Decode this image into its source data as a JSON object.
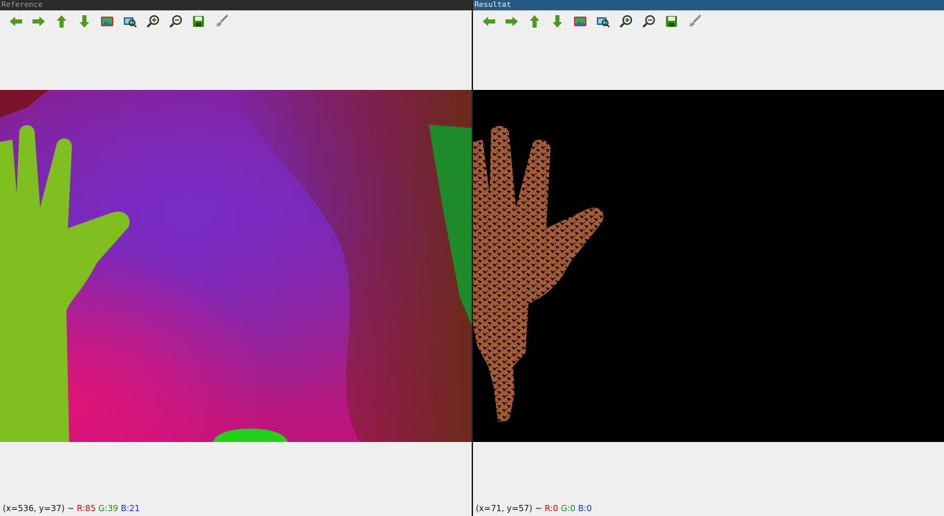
{
  "windows": [
    {
      "title": "Reference",
      "toolbar": [
        {
          "icon": "arrow-left-icon",
          "name": "pan-left-button"
        },
        {
          "icon": "arrow-right-icon",
          "name": "pan-right-button"
        },
        {
          "icon": "arrow-up-icon",
          "name": "pan-up-button"
        },
        {
          "icon": "arrow-down-icon",
          "name": "pan-down-button"
        },
        {
          "icon": "image-icon",
          "name": "zoom-to-original-button"
        },
        {
          "icon": "zoom-fit-icon",
          "name": "zoom-fit-button"
        },
        {
          "icon": "zoom-in-icon",
          "name": "zoom-in-button"
        },
        {
          "icon": "zoom-out-icon",
          "name": "zoom-out-button"
        },
        {
          "icon": "save-icon",
          "name": "save-button"
        },
        {
          "icon": "brush-icon",
          "name": "properties-button"
        }
      ],
      "status": {
        "coords": "(x=536, y=37) ~ ",
        "r": "R:85",
        "g": "G:39",
        "b": "B:21"
      }
    },
    {
      "title": "Resultat",
      "toolbar": [
        {
          "icon": "arrow-left-icon",
          "name": "pan-left-button"
        },
        {
          "icon": "arrow-right-icon",
          "name": "pan-right-button"
        },
        {
          "icon": "arrow-up-icon",
          "name": "pan-up-button"
        },
        {
          "icon": "arrow-down-icon",
          "name": "pan-down-button"
        },
        {
          "icon": "image-icon",
          "name": "zoom-to-original-button"
        },
        {
          "icon": "zoom-fit-icon",
          "name": "zoom-fit-button"
        },
        {
          "icon": "zoom-in-icon",
          "name": "zoom-in-button"
        },
        {
          "icon": "zoom-out-icon",
          "name": "zoom-out-button"
        },
        {
          "icon": "save-icon",
          "name": "save-button"
        },
        {
          "icon": "brush-icon",
          "name": "properties-button"
        }
      ],
      "status": {
        "coords": "(x=71, y=57) ~ ",
        "r": "R:0",
        "g": "G:0",
        "b": "B:0"
      }
    }
  ],
  "colors": {
    "icon_green": "#4f9a1c",
    "reference_hand": "#7fbf1f",
    "result_hand": "#a35c3a"
  }
}
